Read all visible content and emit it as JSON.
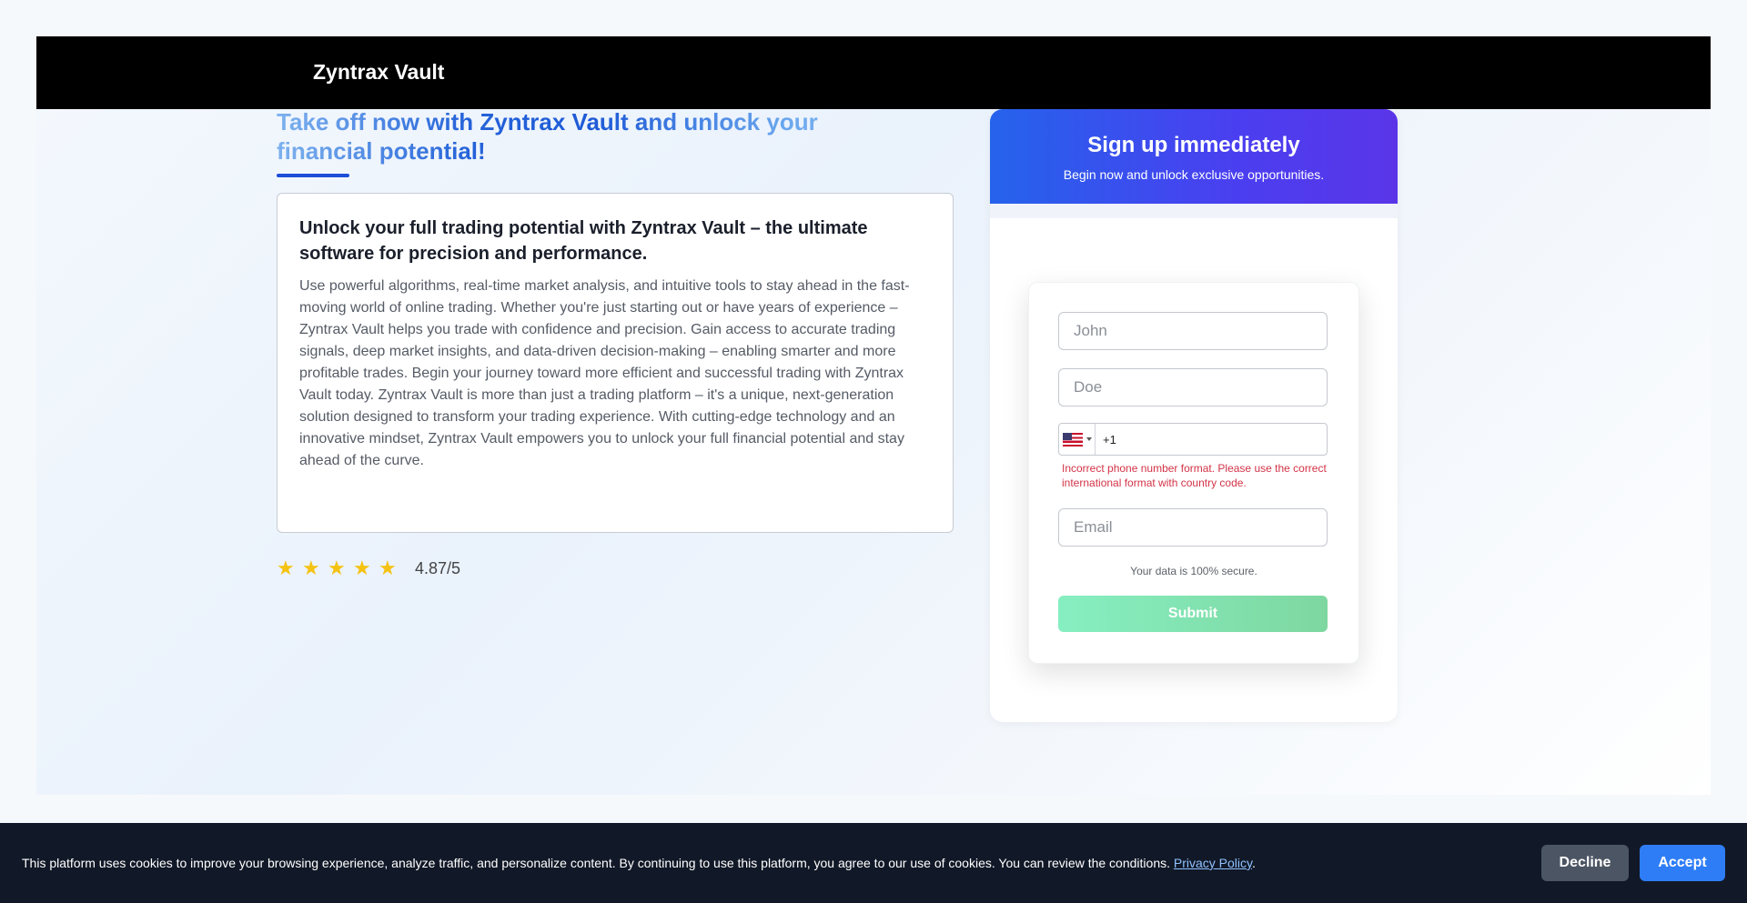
{
  "header": {
    "brand": "Zyntrax Vault"
  },
  "hero": {
    "headline": "Take off now with Zyntrax Vault and unlock your financial potential!",
    "card_title": "Unlock your full trading potential with Zyntrax Vault – the ultimate software for precision and performance.",
    "card_body": "Use powerful algorithms, real-time market analysis, and intuitive tools to stay ahead in the fast-moving world of online trading. Whether you're just starting out or have years of experience – Zyntrax Vault helps you trade with confidence and precision. Gain access to accurate trading signals, deep market insights, and data-driven decision-making – enabling smarter and more profitable trades. Begin your journey toward more efficient and successful trading with Zyntrax Vault today. Zyntrax Vault is more than just a trading platform – it's a unique, next-generation solution designed to transform your trading experience. With cutting-edge technology and an innovative mindset, Zyntrax Vault empowers you to unlock your full financial potential and stay ahead of the curve.",
    "rating": {
      "stars": 5,
      "star_glyph": "★",
      "value": "4.87/5"
    }
  },
  "signup": {
    "title": "Sign up immediately",
    "subtitle": "Begin now and unlock exclusive opportunities.",
    "first_name_placeholder": "John",
    "last_name_placeholder": "Doe",
    "phone": {
      "country_icon": "us-flag-icon",
      "value": "+1"
    },
    "phone_error": "Incorrect phone number format. Please use the correct international format with country code.",
    "email_placeholder": "Email",
    "secure_note": "Your data is 100% secure.",
    "submit_label": "Submit"
  },
  "cookie": {
    "text": "This platform uses cookies to improve your browsing experience, analyze traffic, and personalize content. By continuing to use this platform, you agree to our use of cookies. You can review the conditions.",
    "link_label": "Privacy Policy",
    "suffix": ".",
    "decline_label": "Decline",
    "accept_label": "Accept"
  },
  "colors": {
    "accent": "#2563eb",
    "submit": "#86efc1",
    "error": "#d33347",
    "cookie_bg": "#111827",
    "star": "#f5c211"
  }
}
